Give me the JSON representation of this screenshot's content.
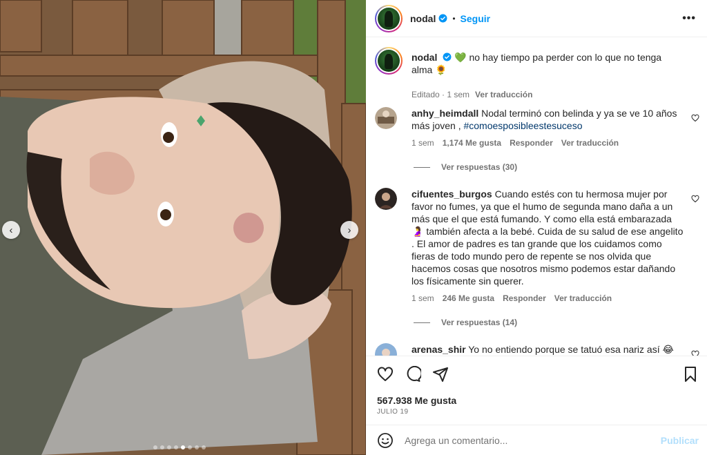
{
  "post": {
    "author": "nodal",
    "follow_label": "Seguir",
    "separator": "•",
    "more_label": "•••"
  },
  "caption": {
    "username": "nodal",
    "text": "💚 no hay tiempo pa perder con lo que no tenga alma 🌻",
    "edited": "Editado · 1 sem",
    "translate": "Ver traducción"
  },
  "comments": [
    {
      "username": "anhy_heimdall",
      "text": "Nodal terminó con belinda y ya se ve 10 años más joven , ",
      "hashtag": "#comoesposibleestesuceso",
      "time": "1 sem",
      "likes": "1,174 Me gusta",
      "reply": "Responder",
      "translate": "Ver traducción",
      "view_replies": "Ver respuestas (30)"
    },
    {
      "username": "cifuentes_burgos",
      "text": "Cuando estés con tu hermosa mujer por favor no fumes, ya que el humo de segunda mano daña a un más que el que está fumando. Y como ella está embarazada 🤰 también afecta a la bebé. Cuida de su salud de ese angelito . El amor de padres es tan grande que los cuidamos como fieras de todo mundo pero de repente se nos olvida que hacemos cosas que nosotros mismo podemos estar dañando los físicamente sin querer.",
      "time": "1 sem",
      "likes": "246 Me gusta",
      "reply": "Responder",
      "translate": "Ver traducción",
      "view_replies": "Ver respuestas (14)"
    },
    {
      "username": "arenas_shir",
      "text": "Yo no entiendo porque se tatuó esa nariz así 😂"
    }
  ],
  "actions": {
    "likes": "567.938 Me gusta",
    "date": "Julio 19"
  },
  "composer": {
    "placeholder": "Agrega un comentario...",
    "publish": "Publicar"
  },
  "carousel": {
    "total": 8,
    "active_index": 4
  },
  "colors": {
    "link": "#0095f6",
    "hashtag": "#00376b",
    "muted": "#737373"
  }
}
